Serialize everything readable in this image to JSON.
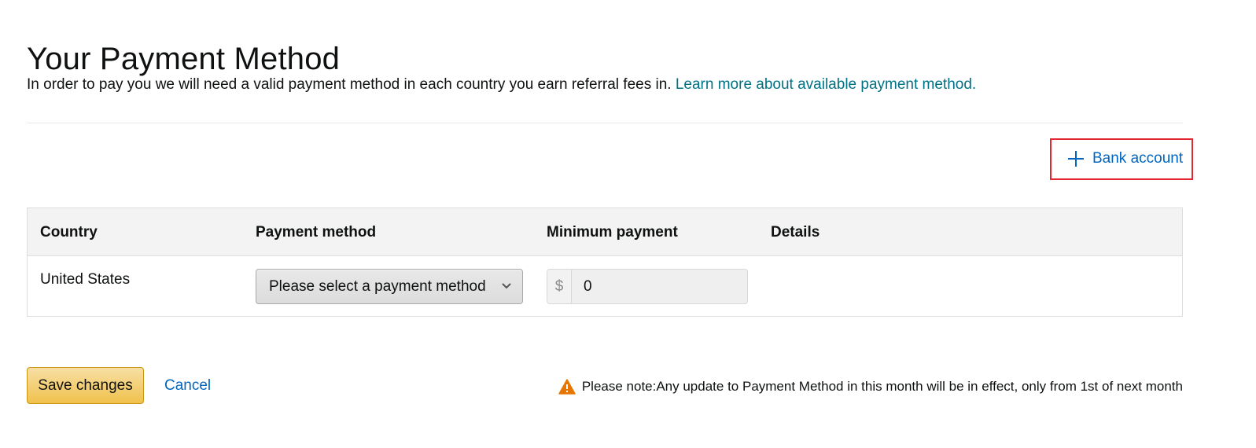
{
  "page": {
    "title": "Your Payment Method",
    "intro_text": "In order to pay you we will need a valid payment method in each country you earn referral fees in.",
    "learn_more_link": "Learn more about available payment method."
  },
  "actions": {
    "add_bank_account_label": "Bank account",
    "save_label": "Save changes",
    "cancel_label": "Cancel"
  },
  "table": {
    "headers": {
      "country": "Country",
      "payment_method": "Payment method",
      "minimum_payment": "Minimum payment",
      "details": "Details"
    },
    "rows": [
      {
        "country": "United States",
        "payment_method_selected": "Please select a payment method",
        "currency_symbol": "$",
        "minimum_payment": "0",
        "details": ""
      }
    ]
  },
  "note": {
    "text": "Please note:Any update to Payment Method in this month will be in effect, only from 1st of next month"
  },
  "colors": {
    "link": "#007185",
    "action_link": "#0066c0",
    "highlight_border": "#e3262f",
    "primary_button": "#f0c14b",
    "warning": "#e77600"
  },
  "icons": {
    "add": "plus-icon",
    "dropdown": "chevron-down-icon",
    "warning": "warning-icon"
  }
}
